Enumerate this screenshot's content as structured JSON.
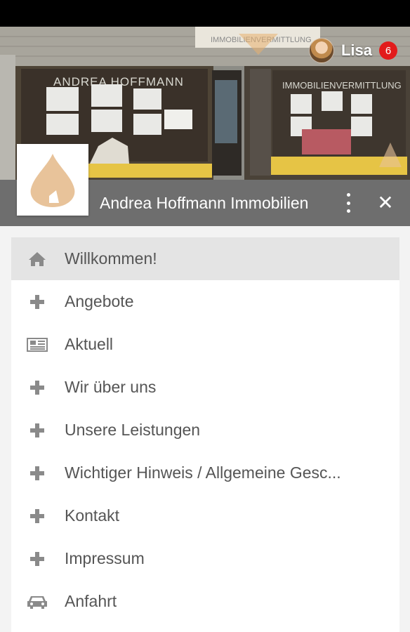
{
  "header": {
    "user_name": "Lisa",
    "notification_count": "6",
    "app_title": "Andrea Hoffmann Immobilien",
    "storefront_sign": "ANDREA HOFFMANN",
    "storefront_sign_right": "IMMOBILIENVERMITTLUNG",
    "storefront_top_sign": "IMMOBILIENVERMITTLUNG"
  },
  "menu": {
    "items": [
      {
        "label": "Willkommen!",
        "icon": "home-icon",
        "active": true
      },
      {
        "label": "Angebote",
        "icon": "plus-icon"
      },
      {
        "label": "Aktuell",
        "icon": "newspaper-icon"
      },
      {
        "label": "Wir über uns",
        "icon": "plus-icon"
      },
      {
        "label": "Unsere Leistungen",
        "icon": "plus-icon"
      },
      {
        "label": "Wichtiger Hinweis / Allgemeine Gesc...",
        "icon": "plus-icon"
      },
      {
        "label": "Kontakt",
        "icon": "plus-icon"
      },
      {
        "label": "Impressum",
        "icon": "plus-icon"
      },
      {
        "label": "Anfahrt",
        "icon": "car-icon"
      }
    ]
  },
  "colors": {
    "titlebar": "#6e6e6e",
    "badge": "#e21b1b",
    "logo_flame": "#e8c39a",
    "active_item": "#e4e4e4",
    "icon_gray": "#8a8a8a"
  }
}
